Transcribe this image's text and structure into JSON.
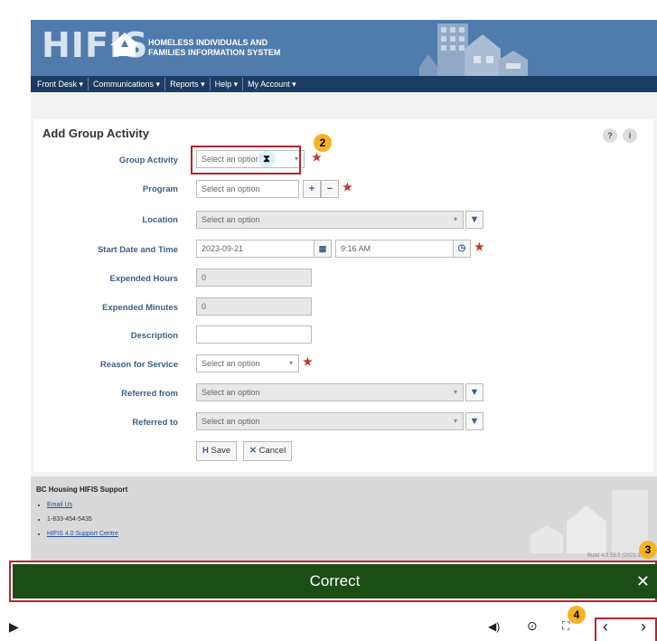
{
  "header": {
    "logo_text": "HIFIS",
    "logo_subtitle_line1": "HOMELESS INDIVIDUALS AND",
    "logo_subtitle_line2": "FAMILIES INFORMATION SYSTEM"
  },
  "nav": [
    {
      "label": "Front Desk ▾"
    },
    {
      "label": "Communications ▾"
    },
    {
      "label": "Reports ▾"
    },
    {
      "label": "Help ▾"
    },
    {
      "label": "My Account ▾"
    }
  ],
  "form": {
    "title": "Add Group Activity",
    "fields": {
      "group_activity": {
        "label": "Group Activity",
        "value": "Select an option"
      },
      "program": {
        "label": "Program",
        "value": "Select an option"
      },
      "location": {
        "label": "Location",
        "value": "Select an option"
      },
      "start": {
        "label": "Start Date and Time",
        "date": "2023-09-21",
        "time": "9:16 AM"
      },
      "expended_hours": {
        "label": "Expended Hours",
        "value": "0"
      },
      "expended_minutes": {
        "label": "Expended Minutes",
        "value": "0"
      },
      "description": {
        "label": "Description",
        "value": ""
      },
      "reason": {
        "label": "Reason for Service",
        "value": "Select an option"
      },
      "referred_from": {
        "label": "Referred from",
        "value": "Select an option"
      },
      "referred_to": {
        "label": "Referred to",
        "value": "Select an option"
      }
    },
    "save_label": "Save",
    "cancel_label": "Cancel"
  },
  "footer": {
    "title": "BC Housing HIFIS Support",
    "email": "Email Us",
    "phone": "1-833-454-5435",
    "support": "HIFIS 4.0 Support Centre",
    "build": "Build 4.0.59.5 (2021-10-29)"
  },
  "feedback": {
    "text": "Correct"
  },
  "callouts": [
    "2",
    "3",
    "4"
  ],
  "colors": {
    "banner": "#4f7cac",
    "navbar": "#1b3d63",
    "correct_bar": "#1b4d16",
    "highlight": "#b3262f",
    "badge": "#f5b324"
  }
}
